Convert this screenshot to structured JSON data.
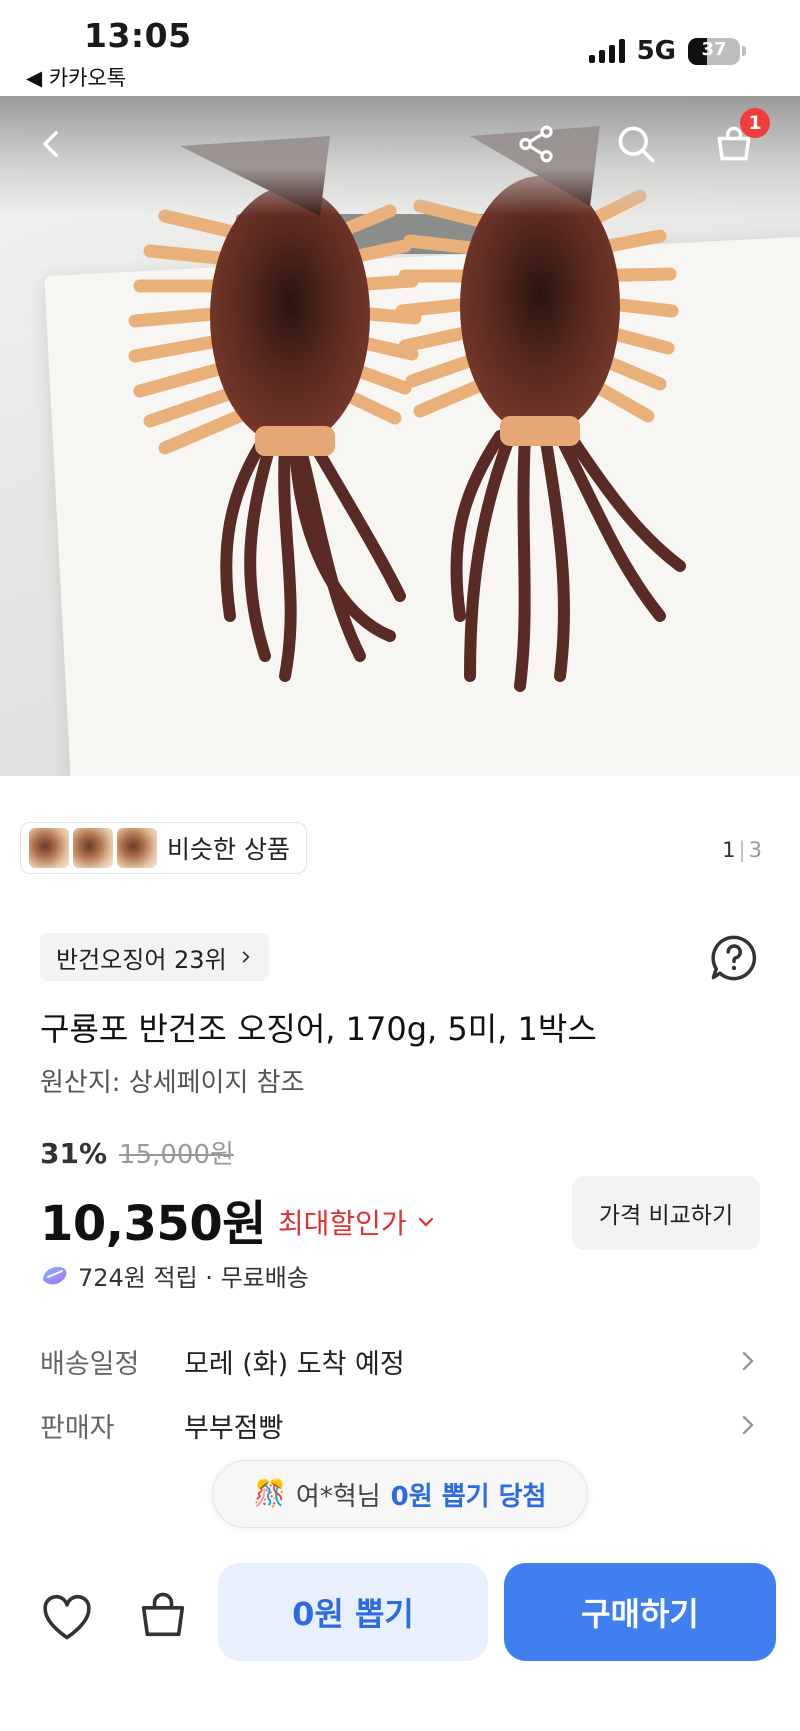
{
  "status_bar": {
    "time": "13:05",
    "back_app": "◀ 카카오톡",
    "network": "5G",
    "battery": "37",
    "battery_level": 0.37
  },
  "nav": {
    "cart_count": "1",
    "icons": [
      "back-arrow-icon",
      "share-icon",
      "search-icon",
      "shopping-bag-icon"
    ]
  },
  "gallery": {
    "similar_label": "비슷한 상품",
    "page_current": "1",
    "page_sep": "|",
    "page_total": "3"
  },
  "product": {
    "rank_label": "반건오징어 23위",
    "title": "구룡포 반건조 오징어, 170g, 5미, 1박스",
    "origin": "원산지: 상세페이지 참조",
    "discount_pct": "31%",
    "original_price": "15,000원",
    "price": "10,350원",
    "max_discount_label": "최대할인가",
    "compare_label": "가격 비교하기",
    "reward_text": "724원 적립 · 무료배송"
  },
  "info": [
    {
      "label": "배송일정",
      "value": "모레 (화) 도착 예정"
    },
    {
      "label": "판매자",
      "value": "부부점빵"
    }
  ],
  "winner": {
    "emoji": "🎊",
    "name": "여*혁님",
    "prize": "0원 뽑기 당첨"
  },
  "bottom": {
    "draw_label": "0원 뽑기",
    "buy_label": "구매하기"
  },
  "colors": {
    "accent": "#3f7ff0",
    "accent_light": "#e8f0fd",
    "sale_red": "#e03131",
    "badge_red": "#f23c3c"
  }
}
